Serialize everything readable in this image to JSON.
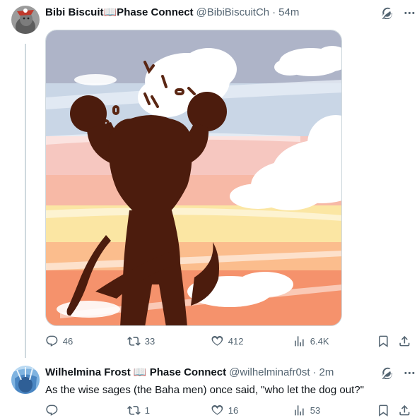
{
  "tweets": [
    {
      "display_name": "Bibi Biscuit📖Phase Connect",
      "handle": "@BibiBiscuitCh",
      "separator": "·",
      "time": "54m",
      "stats": {
        "replies": "46",
        "reposts": "33",
        "likes": "412",
        "views": "6.4K"
      }
    },
    {
      "display_name": "Wilhelmina Frost 📖 Phase Connect",
      "handle": "@wilhelminafr0st",
      "separator": "·",
      "time": "2m",
      "text": "As the wise sages (the Baha men) once said, \"who let the dog out?\"",
      "stats": {
        "replies": "",
        "reposts": "1",
        "likes": "16",
        "views": "53"
      }
    }
  ],
  "icons": {
    "grok": "grok-icon",
    "more": "more-icon",
    "reply": "reply-icon",
    "repost": "repost-icon",
    "like": "like-icon",
    "views": "views-icon",
    "bookmark": "bookmark-icon",
    "share": "share-icon"
  },
  "colors": {
    "text": "#0f1419",
    "secondary": "#536471",
    "border": "#cfd9de"
  }
}
